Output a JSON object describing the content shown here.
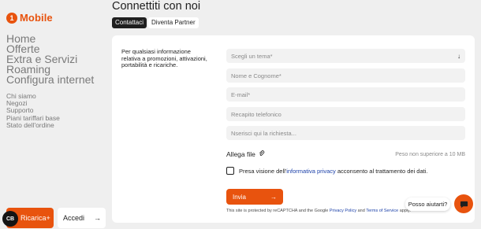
{
  "brand": {
    "logo_mark": "1",
    "logo_text": "Mobile",
    "accent": "#e8530e"
  },
  "main_nav": [
    "Home",
    "Offerte",
    "Extra e Servizi",
    "Roaming",
    "Configura internet"
  ],
  "sub_nav": [
    "Chi siamo",
    "Negozi",
    "Supporto",
    "Piani tariffari base",
    "Stato dell'ordine"
  ],
  "bottom_buttons": {
    "ricarica": "Ricarica",
    "accedi": "Accedi"
  },
  "cookie_button": "CB",
  "page_title": "Connettiti con noi",
  "tabs": [
    {
      "label": "Contattaci",
      "active": true
    },
    {
      "label": "Diventa Partner",
      "active": false
    }
  ],
  "info_text": "Per qualsiasi informazione relativa a promozioni, attivazioni, portabilità e ricariche.",
  "form": {
    "topic_placeholder": "Scegli un tema*",
    "name_placeholder": "Nome e Cognome*",
    "email_placeholder": "E-mail*",
    "phone_placeholder": "Recapito telefonico",
    "request_placeholder": "Nserisci qui la richiesta...",
    "attach_label": "Allega file",
    "attach_hint": "Peso non superiore a 10 MB",
    "privacy_prefix": "Presa visione dell'",
    "privacy_link": "informativa privacy",
    "privacy_suffix": " acconsento al trattamento dei dati.",
    "submit_label": "Invia"
  },
  "recaptcha": {
    "prefix": "This site is protected by reCAPTCHA and the Google ",
    "privacy_policy": "Privacy Policy",
    "and": " and ",
    "terms": "Terms of Service",
    "suffix": " apply."
  },
  "chat": {
    "prompt": "Posso aiutarti?"
  }
}
